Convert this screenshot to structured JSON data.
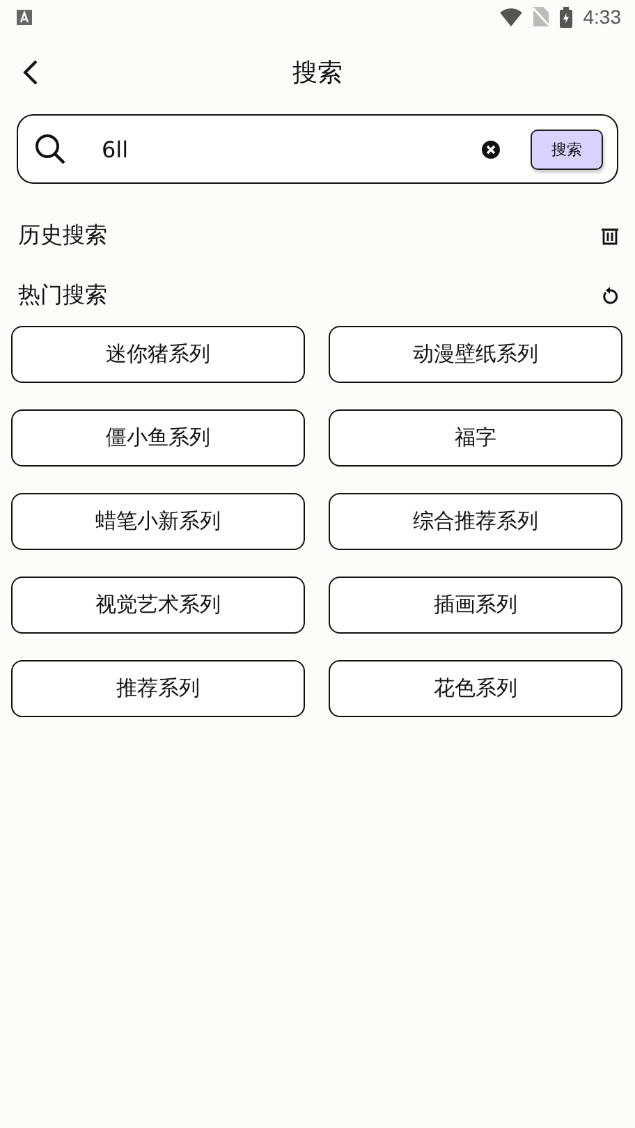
{
  "status_bar": {
    "time": "4:33"
  },
  "header": {
    "title": "搜索"
  },
  "search": {
    "value": "6ll",
    "button": "搜索"
  },
  "history": {
    "title": "历史搜索"
  },
  "hot": {
    "title": "热门搜索",
    "items": [
      {
        "label": "迷你猪系列"
      },
      {
        "label": "动漫壁纸系列"
      },
      {
        "label": "僵小鱼系列"
      },
      {
        "label": "福字"
      },
      {
        "label": "蜡笔小新系列"
      },
      {
        "label": "综合推荐系列"
      },
      {
        "label": "视觉艺术系列"
      },
      {
        "label": "插画系列"
      },
      {
        "label": "推荐系列"
      },
      {
        "label": "花色系列"
      }
    ]
  }
}
